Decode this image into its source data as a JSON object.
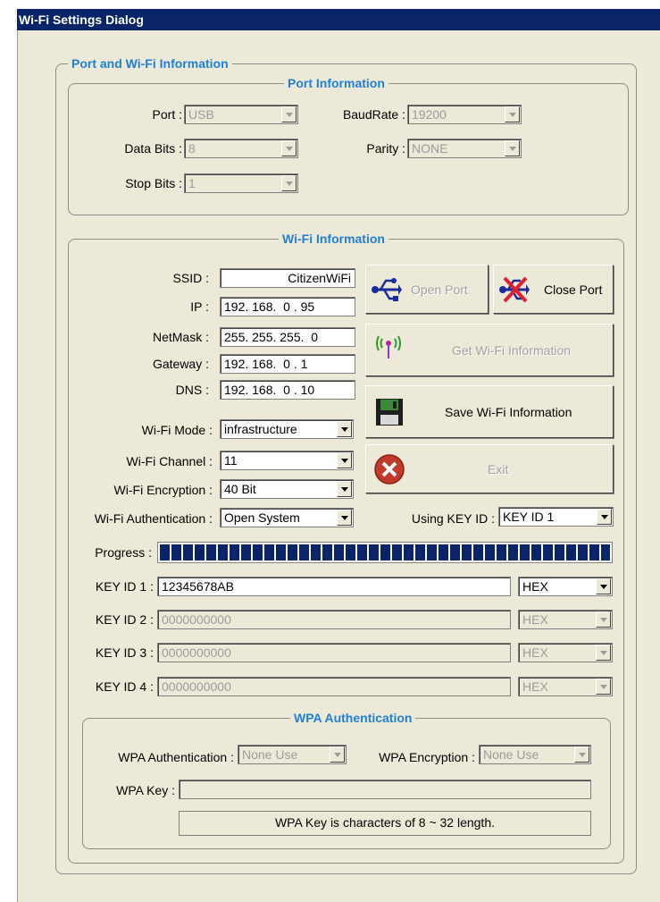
{
  "window": {
    "title": "Wi-Fi Settings Dialog"
  },
  "port_wifi_group": {
    "title": "Port and Wi-Fi Information"
  },
  "port_info": {
    "title": "Port Information",
    "port_label": "Port :",
    "port_value": "USB",
    "baudrate_label": "BaudRate :",
    "baudrate_value": "19200",
    "databits_label": "Data Bits :",
    "databits_value": "8",
    "parity_label": "Parity :",
    "parity_value": "NONE",
    "stopbits_label": "Stop Bits :",
    "stopbits_value": "1"
  },
  "wifi_info": {
    "title": "Wi-Fi Information",
    "ssid_label": "SSID :",
    "ssid_value": "CitizenWiFi",
    "ip_label": "IP :",
    "ip_value": "192. 168.  0 . 95",
    "netmask_label": "NetMask :",
    "netmask_value": "255. 255. 255.  0",
    "gateway_label": "Gateway :",
    "gateway_value": "192. 168.  0 . 1",
    "dns_label": "DNS :",
    "dns_value": "192. 168.  0 . 10",
    "mode_label": "Wi-Fi Mode :",
    "mode_value": "infrastructure",
    "channel_label": "Wi-Fi Channel :",
    "channel_value": "11",
    "encryption_label": "Wi-Fi Encryption :",
    "encryption_value": "40 Bit",
    "auth_label": "Wi-Fi Authentication :",
    "auth_value": "Open System",
    "keyid_label": "Using KEY ID :",
    "keyid_value": "KEY ID 1",
    "progress_label": "Progress :",
    "progress_value": 1.0
  },
  "buttons": {
    "open_port": "Open Port",
    "close_port": "Close Port",
    "get_wifi": "Get Wi-Fi Information",
    "save_wifi": "Save Wi-Fi Information",
    "exit": "Exit"
  },
  "keys": [
    {
      "label": "KEY ID 1 :",
      "value": "12345678AB",
      "format": "HEX",
      "enabled": true
    },
    {
      "label": "KEY ID 2 :",
      "value": "0000000000",
      "format": "HEX",
      "enabled": false
    },
    {
      "label": "KEY ID 3 :",
      "value": "0000000000",
      "format": "HEX",
      "enabled": false
    },
    {
      "label": "KEY ID 4 :",
      "value": "0000000000",
      "format": "HEX",
      "enabled": false
    }
  ],
  "wpa": {
    "title": "WPA Authentication",
    "auth_label": "WPA Authentication :",
    "auth_value": "None Use",
    "enc_label": "WPA Encryption :",
    "enc_value": "None Use",
    "key_label": "WPA Key :",
    "key_value": "",
    "note": "WPA Key is characters of 8 ~ 32 length."
  },
  "colors": {
    "titlebar": "#0a246a",
    "group_title": "#1f7fd4",
    "dialog_bg": "#ece9d8",
    "progress": "#0a246a"
  }
}
